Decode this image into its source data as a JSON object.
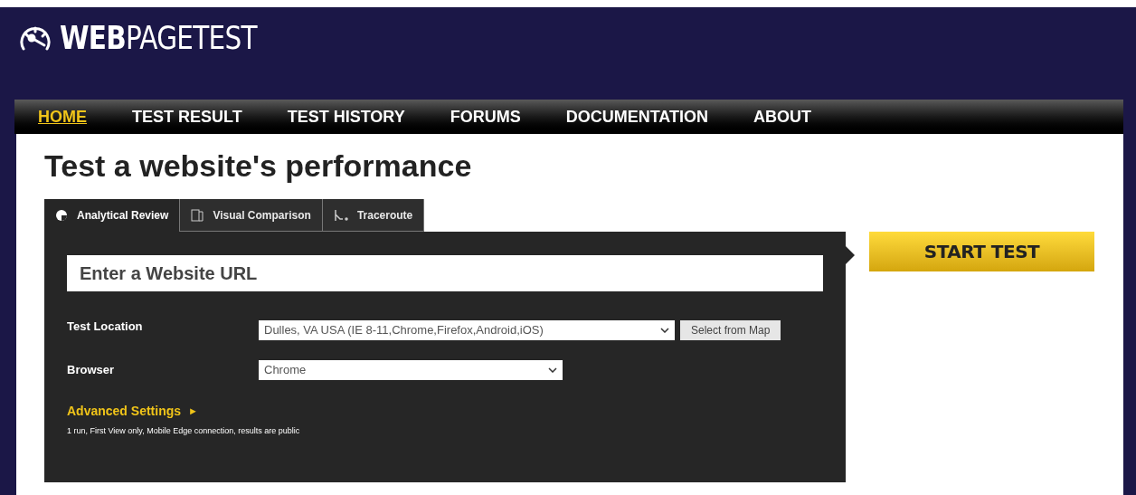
{
  "logo": {
    "text": "**WEB**PAGETEST"
  },
  "nav": [
    {
      "label": "HOME",
      "selected": true
    },
    {
      "label": "TEST RESULT",
      "selected": false
    },
    {
      "label": "TEST HISTORY",
      "selected": false
    },
    {
      "label": "FORUMS",
      "selected": false
    },
    {
      "label": "DOCUMENTATION",
      "selected": false
    },
    {
      "label": "ABOUT",
      "selected": false
    }
  ],
  "heading": "Test a website's performance",
  "tabs": [
    {
      "label": "Analytical Review",
      "kind": "analytical",
      "selected": true
    },
    {
      "label": "Visual Comparison",
      "kind": "visual",
      "selected": false
    },
    {
      "label": "Traceroute",
      "kind": "traceroute",
      "selected": false
    }
  ],
  "url_field": {
    "placeholder": "Enter a Website URL"
  },
  "test_location": {
    "label": "Test Location",
    "value": "Dulles, VA USA (IE 8-11,Chrome,Firefox,Android,iOS)",
    "button": "Select from Map"
  },
  "browser": {
    "label": "Browser",
    "value": "Chrome"
  },
  "advanced_settings": {
    "label": "Advanced Settings",
    "arrow": "►",
    "summary": "1 run, First View only, Mobile Edge connection, results are public"
  },
  "start_button": "START TEST"
}
